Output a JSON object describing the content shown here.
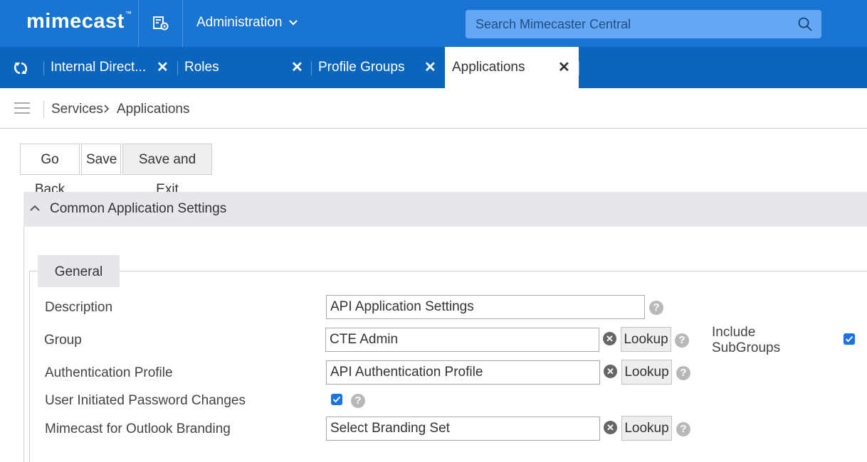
{
  "header": {
    "logo": "mimecast",
    "logo_tm": "™",
    "app_icon": "admin-grid-gear-icon",
    "menu_label": "Administration",
    "search_placeholder": "Search Mimecaster Central"
  },
  "tabs": [
    {
      "label": "Internal Direct...",
      "close": "✕",
      "active": false
    },
    {
      "label": "Roles",
      "close": "✕",
      "active": false
    },
    {
      "label": "Profile Groups",
      "close": "✕",
      "active": false
    },
    {
      "label": "Applications",
      "close": "✕",
      "active": true
    }
  ],
  "breadcrumb": {
    "items": [
      "Services",
      "Applications"
    ],
    "separator": "›"
  },
  "toolbar": {
    "go_back": "Go Back",
    "save": "Save",
    "save_exit": "Save and Exit"
  },
  "section": {
    "title": "Common Application Settings",
    "tab_general": "General"
  },
  "form": {
    "description": {
      "label": "Description",
      "value": "API Application Settings"
    },
    "group": {
      "label": "Group",
      "value": "CTE Admin",
      "lookup": "Lookup"
    },
    "include_subgroups": {
      "label_line1": "Include",
      "label_line2": "SubGroups",
      "checked": true
    },
    "auth_profile": {
      "label": "Authentication Profile",
      "value": "API Authentication Profile",
      "lookup": "Lookup"
    },
    "password_changes": {
      "label": "User Initiated Password Changes",
      "checked": true
    },
    "branding": {
      "label": "Mimecast for Outlook Branding",
      "value": "Select Branding Set",
      "lookup": "Lookup"
    },
    "help_glyph": "?",
    "clear_glyph": "✕"
  },
  "colors": {
    "topbar": "#1a74d2",
    "tabbar": "#0c65bc",
    "search_bg": "#64a7f4",
    "section_bg": "#e5e7ea",
    "checkbox": "#1a73e8"
  }
}
